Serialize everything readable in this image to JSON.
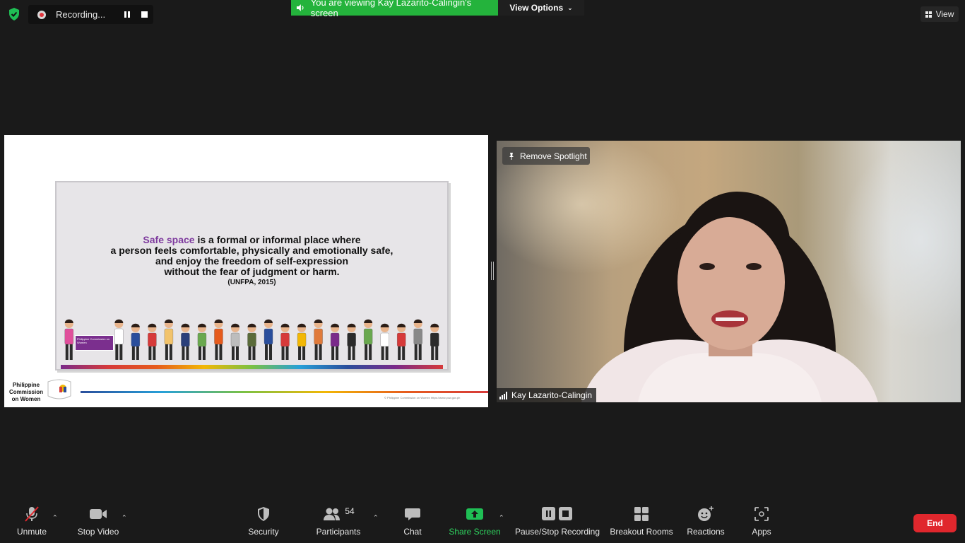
{
  "top_bar": {
    "recording_label": "Recording...",
    "viewing_banner": "You are viewing Kay Lazarito-Calingin's screen",
    "view_options_label": "View Options",
    "view_label": "View"
  },
  "slide": {
    "quote_emphasis": "Safe space",
    "quote_line1_rest": " is a formal or informal place where",
    "quote_line2": "a person feels comfortable, physically and emotionally safe,",
    "quote_line3": "and enjoy the freedom of self-expression",
    "quote_line4": "without the fear of judgment or harm.",
    "citation": "(UNFPA, 2015)",
    "badge_text": "Philippine Commission on Women",
    "logo_text": "Philippine Commission on Women",
    "credit": "© Philippine Commission on Women https://www.pcw.gov.ph"
  },
  "video": {
    "spotlight_label": "Remove Spotlight",
    "participant_name": "Kay Lazarito-Calingin"
  },
  "toolbar": {
    "unmute": "Unmute",
    "stop_video": "Stop Video",
    "security": "Security",
    "participants": "Participants",
    "participants_count": "54",
    "chat": "Chat",
    "share_screen": "Share Screen",
    "pause_stop_recording": "Pause/Stop Recording",
    "breakout_rooms": "Breakout Rooms",
    "reactions": "Reactions",
    "apps": "Apps",
    "end": "End"
  },
  "colors": {
    "banner_green": "#24b33c",
    "share_green": "#1fbf55",
    "end_red": "#e0272d",
    "emphasis_purple": "#7e3a9e"
  }
}
